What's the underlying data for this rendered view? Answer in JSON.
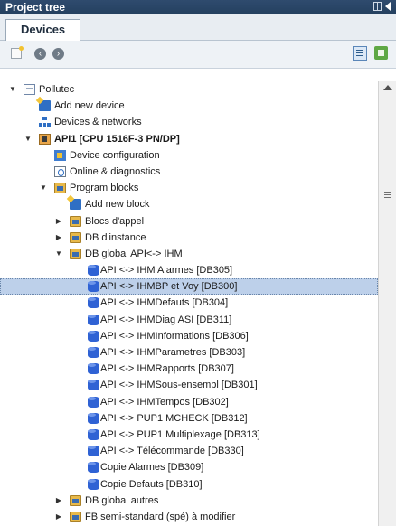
{
  "panel": {
    "title": "Project tree"
  },
  "tabs": [
    {
      "label": "Devices"
    }
  ],
  "toolbar": {
    "icons": [
      "new-icon",
      "back-icon",
      "forward-icon",
      "detail-view-icon",
      "export-icon"
    ]
  },
  "tree": [
    {
      "label": "Pollutec",
      "icon": "project",
      "arrow": "▼",
      "indent": 0,
      "bold": false
    },
    {
      "label": "Add new device",
      "icon": "add",
      "arrow": "",
      "indent": 1,
      "bold": false
    },
    {
      "label": "Devices & networks",
      "icon": "network",
      "arrow": "",
      "indent": 1,
      "bold": false
    },
    {
      "label": "API1 [CPU 1516F-3 PN/DP]",
      "icon": "cpu",
      "arrow": "▼",
      "indent": 1,
      "bold": true
    },
    {
      "label": "Device configuration",
      "icon": "devconf",
      "arrow": "",
      "indent": 2,
      "bold": false
    },
    {
      "label": "Online & diagnostics",
      "icon": "diag",
      "arrow": "",
      "indent": 2,
      "bold": false
    },
    {
      "label": "Program blocks",
      "icon": "folder",
      "arrow": "▼",
      "indent": 2,
      "bold": false
    },
    {
      "label": "Add new block",
      "icon": "add",
      "arrow": "",
      "indent": 3,
      "bold": false
    },
    {
      "label": "Blocs d'appel",
      "icon": "folder",
      "arrow": "▶",
      "indent": 3,
      "bold": false
    },
    {
      "label": "DB d'instance",
      "icon": "folder",
      "arrow": "▶",
      "indent": 3,
      "bold": false
    },
    {
      "label": "DB global API<-> IHM",
      "icon": "folder",
      "arrow": "▼",
      "indent": 3,
      "bold": false
    },
    {
      "label": "API <-> IHM Alarmes [DB305]",
      "icon": "db",
      "arrow": "",
      "indent": 4,
      "bold": false
    },
    {
      "label": "API <-> IHMBP et Voy [DB300]",
      "icon": "db",
      "arrow": "",
      "indent": 4,
      "bold": false,
      "selected": true
    },
    {
      "label": "API <-> IHMDefauts [DB304]",
      "icon": "db",
      "arrow": "",
      "indent": 4,
      "bold": false
    },
    {
      "label": "API <-> IHMDiag ASI [DB311]",
      "icon": "db",
      "arrow": "",
      "indent": 4,
      "bold": false
    },
    {
      "label": "API <-> IHMInformations [DB306]",
      "icon": "db",
      "arrow": "",
      "indent": 4,
      "bold": false
    },
    {
      "label": "API <-> IHMParametres [DB303]",
      "icon": "db",
      "arrow": "",
      "indent": 4,
      "bold": false
    },
    {
      "label": "API <-> IHMRapports [DB307]",
      "icon": "db",
      "arrow": "",
      "indent": 4,
      "bold": false
    },
    {
      "label": "API <-> IHMSous-ensembl [DB301]",
      "icon": "db",
      "arrow": "",
      "indent": 4,
      "bold": false
    },
    {
      "label": "API <-> IHMTempos [DB302]",
      "icon": "db",
      "arrow": "",
      "indent": 4,
      "bold": false
    },
    {
      "label": "API <-> PUP1 MCHECK [DB312]",
      "icon": "db",
      "arrow": "",
      "indent": 4,
      "bold": false
    },
    {
      "label": "API <-> PUP1 Multiplexage [DB313]",
      "icon": "db",
      "arrow": "",
      "indent": 4,
      "bold": false
    },
    {
      "label": "API <-> Télécommande [DB330]",
      "icon": "db",
      "arrow": "",
      "indent": 4,
      "bold": false
    },
    {
      "label": "Copie Alarmes [DB309]",
      "icon": "db",
      "arrow": "",
      "indent": 4,
      "bold": false
    },
    {
      "label": "Copie Defauts [DB310]",
      "icon": "db",
      "arrow": "",
      "indent": 4,
      "bold": false
    },
    {
      "label": "DB global autres",
      "icon": "folder",
      "arrow": "▶",
      "indent": 3,
      "bold": false
    },
    {
      "label": "FB semi-standard (spé) à modifier",
      "icon": "folder",
      "arrow": "▶",
      "indent": 3,
      "bold": false
    }
  ],
  "colors": {
    "title_bar": "#2f4b6e",
    "selection": "#bdd0ea",
    "db_icon": "#2f62d4",
    "folder_icon": "#e8b94a"
  }
}
